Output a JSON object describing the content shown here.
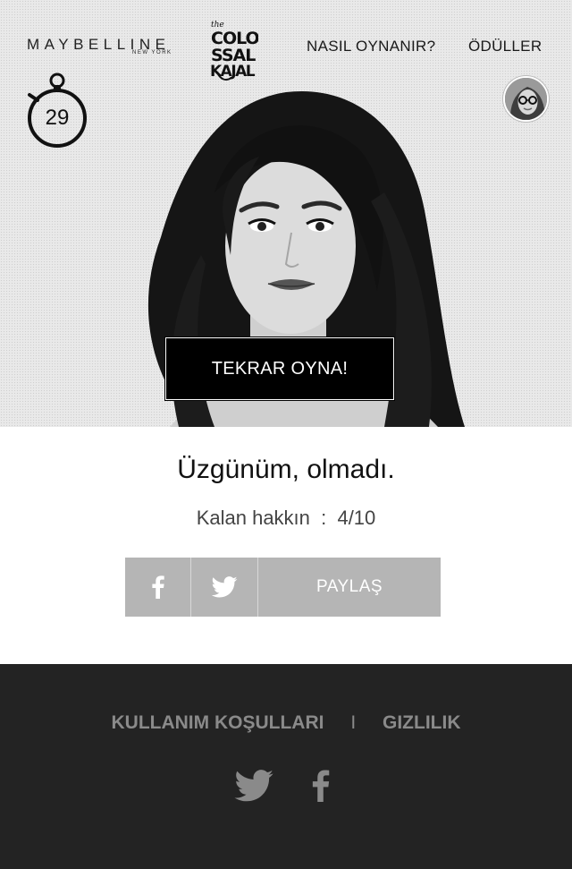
{
  "header": {
    "brand_logo": "MAYBELLINE",
    "brand_logo_sub": "NEW YORK",
    "campaign_logo_lines": [
      "the",
      "COLO",
      "SSAL",
      "KAJAL"
    ],
    "nav": {
      "how_to_play": "NASIL OYNANIR?",
      "prizes": "ÖDÜLLER"
    }
  },
  "game": {
    "timer_value": "29",
    "timer_icon": "stopwatch-icon",
    "replay_label": "TEKRAR OYNA!"
  },
  "result": {
    "title": "Üzgünüm, olmadı.",
    "remaining_text": "Kalan hakkın  :  4/10"
  },
  "share": {
    "facebook_icon": "facebook-icon",
    "twitter_icon": "twitter-icon",
    "label": "PAYLAŞ"
  },
  "footer": {
    "terms_label": "KULLANIM KOŞULLARI",
    "separator": "I",
    "privacy_label": "GIZLILIK",
    "social_icons": [
      "twitter-icon",
      "facebook-icon"
    ]
  },
  "colors": {
    "footer_bg": "#232323",
    "share_bg": "#b5b5b5",
    "button_bg": "#000000"
  }
}
